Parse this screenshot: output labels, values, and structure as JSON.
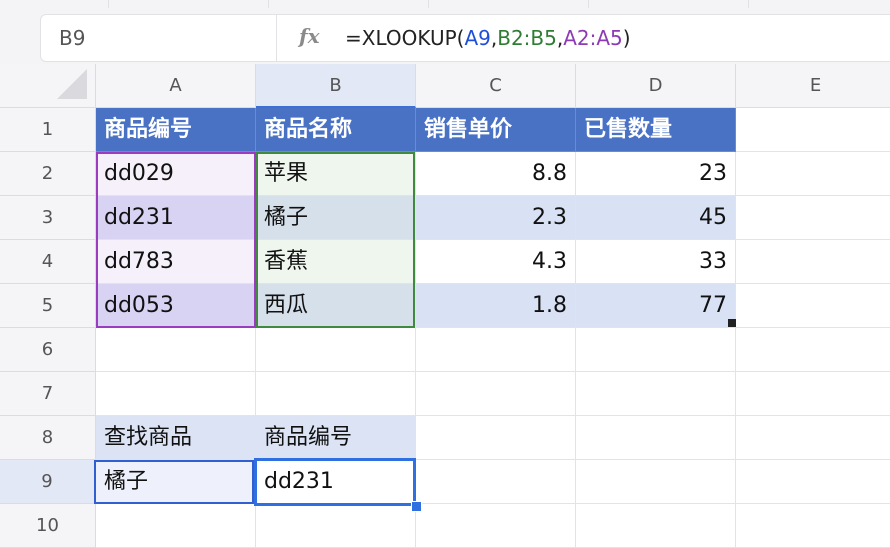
{
  "name_box": "B9",
  "formula_bar": {
    "icon": "fx-icon",
    "prefix": "=XLOOKUP(",
    "arg1": "A9",
    "sep1": ",",
    "arg2": "B2:B5",
    "sep2": ",",
    "arg3": "A2:A5",
    "suffix": ")"
  },
  "columns": [
    "A",
    "B",
    "C",
    "D",
    "E"
  ],
  "rows": [
    "1",
    "2",
    "3",
    "4",
    "5",
    "6",
    "7",
    "8",
    "9",
    "10"
  ],
  "table": {
    "headers": [
      "商品编号",
      "商品名称",
      "销售单价",
      "已售数量"
    ],
    "rows": [
      [
        "dd029",
        "苹果",
        "8.8",
        "23"
      ],
      [
        "dd231",
        "橘子",
        "2.3",
        "45"
      ],
      [
        "dd783",
        "香蕉",
        "4.3",
        "33"
      ],
      [
        "dd053",
        "西瓜",
        "1.8",
        "77"
      ]
    ]
  },
  "lookup": {
    "label_a": "查找商品",
    "label_b": "商品编号",
    "input": "橘子",
    "result": "dd231"
  },
  "colors": {
    "header_fill": "#4a72c4",
    "band_fill": "#d9e1f5",
    "range_a_border": "#9b3bc0",
    "range_b_border": "#3f8a3f",
    "selection": "#2f6fe0"
  }
}
